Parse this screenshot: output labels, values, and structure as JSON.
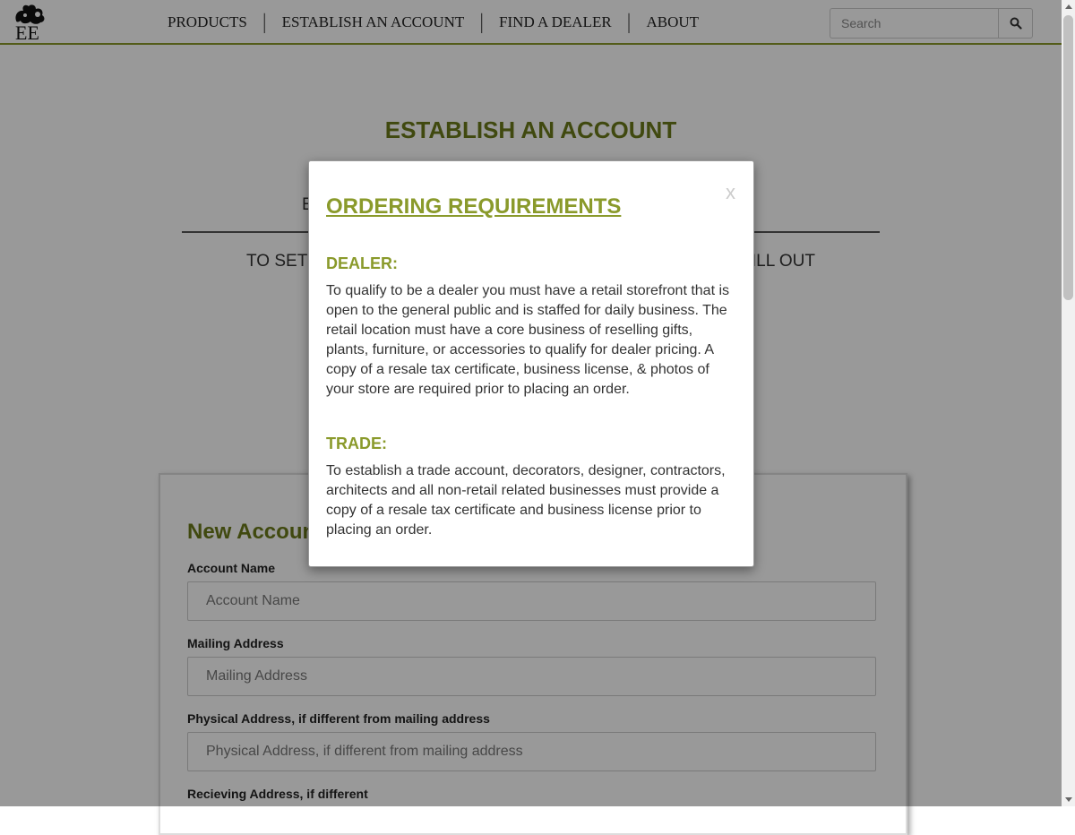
{
  "header": {
    "logo_text": "EE",
    "nav": [
      "PRODUCTS",
      "ESTABLISH AN ACCOUNT",
      "FIND A DEALER",
      "ABOUT"
    ],
    "search_placeholder": "Search"
  },
  "page": {
    "title": "ESTABLISH AN ACCOUNT",
    "sub_head": "E",
    "instructions": "TO SET UP AN A                                                       MENTS AND FILL OUT                                                    OW."
  },
  "form": {
    "title": "New Accoun",
    "fields": [
      {
        "label": "Account Name",
        "placeholder": "Account Name"
      },
      {
        "label": "Mailing Address",
        "placeholder": "Mailing Address"
      },
      {
        "label": "Physical Address, if different from mailing address",
        "placeholder": "Physical Address, if different from mailing address"
      },
      {
        "label": "Recieving Address, if different",
        "placeholder": ""
      }
    ]
  },
  "modal": {
    "close": "x",
    "title": "ORDERING REQUIREMENTS",
    "dealer_head": "DEALER:",
    "dealer_text": "To qualify to be a dealer you must have a retail storefront that is open to the general public and is staffed for daily business. The retail location must have a core business of reselling gifts, plants, furniture, or accessories to qualify for dealer pricing. A copy of a resale tax certificate, business license, & photos of your store are required prior to placing an order.",
    "trade_head": "TRADE:",
    "trade_text": "To establish a trade account, decorators, designer, contractors, architects and all non-retail related businesses must provide a copy of a resale tax certificate and business license prior to placing an order."
  },
  "colors": {
    "accent": "#8a9a2b",
    "title_green": "#6b7a1a",
    "overlay": "rgba(0,0,0,0.4)"
  },
  "icons": {
    "logo": "fleur-leaf-icon",
    "search": "search-icon"
  }
}
